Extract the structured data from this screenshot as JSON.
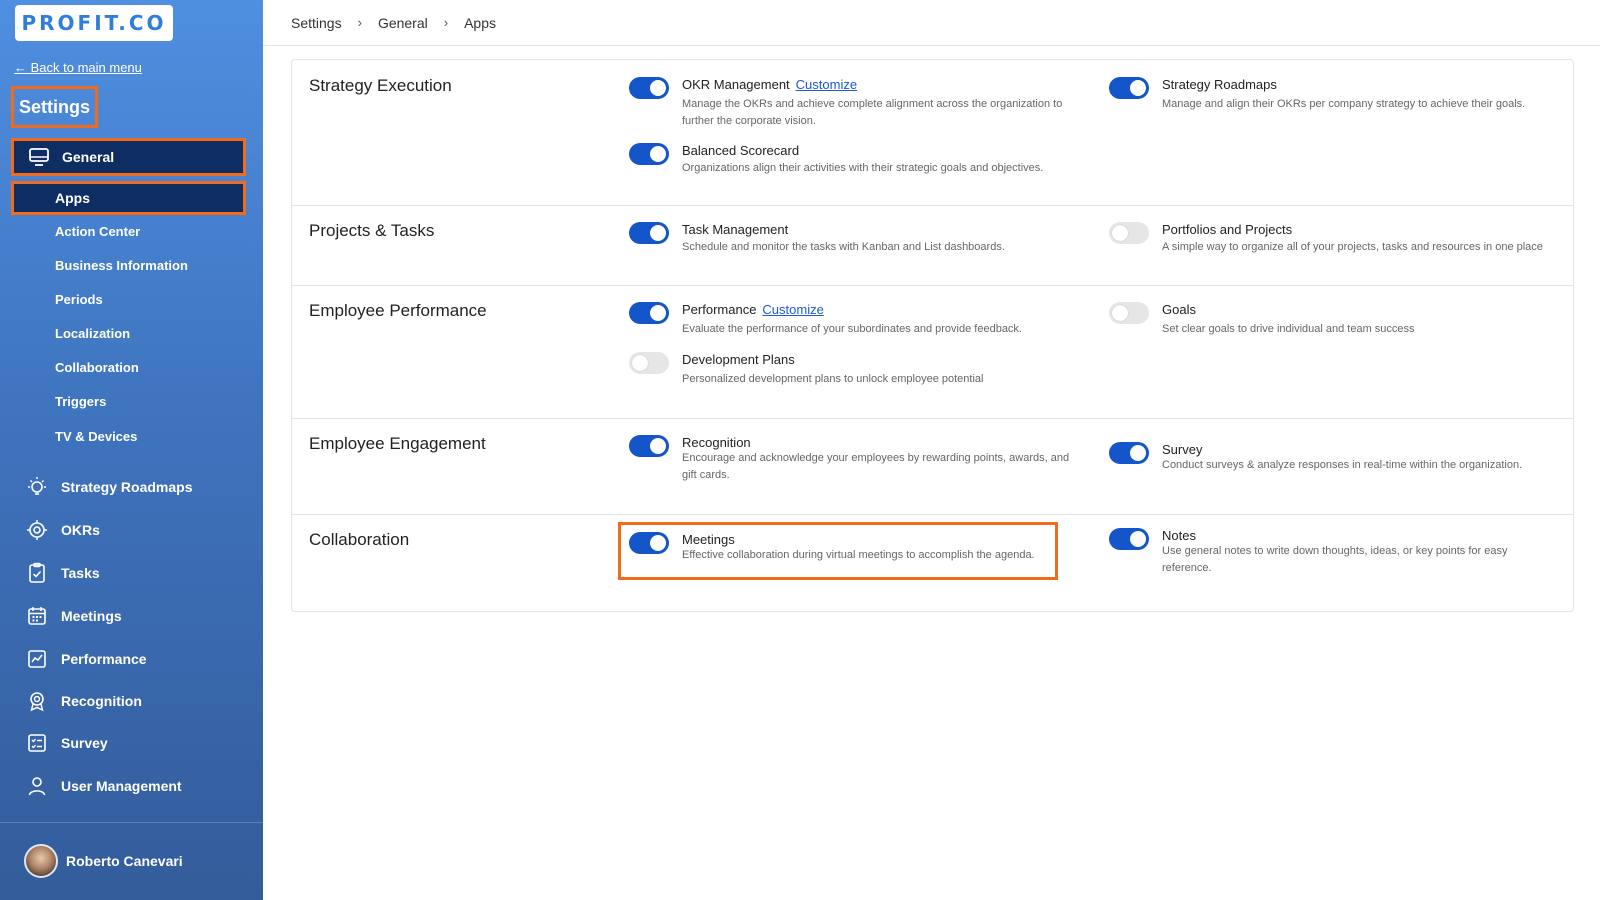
{
  "logo": {
    "text": "PROFIT.CO"
  },
  "sidebar": {
    "back_link": "← Back to main menu",
    "title": "Settings",
    "general": "General",
    "apps": "Apps",
    "subitems": [
      "Action Center",
      "Business Information",
      "Periods",
      "Localization",
      "Collaboration",
      "Triggers",
      "TV & Devices"
    ],
    "items": [
      {
        "label": "Strategy Roadmaps",
        "icon": "lightbulb-icon"
      },
      {
        "label": "OKRs",
        "icon": "target-icon"
      },
      {
        "label": "Tasks",
        "icon": "clipboard-check-icon"
      },
      {
        "label": "Meetings",
        "icon": "calendar-icon"
      },
      {
        "label": "Performance",
        "icon": "chart-line-icon"
      },
      {
        "label": "Recognition",
        "icon": "award-badge-icon"
      },
      {
        "label": "Survey",
        "icon": "survey-list-icon"
      },
      {
        "label": "User Management",
        "icon": "user-icon"
      }
    ],
    "user": {
      "name": "Roberto Canevari"
    }
  },
  "breadcrumb": [
    "Settings",
    "General",
    "Apps"
  ],
  "sections": [
    {
      "title": "Strategy Execution",
      "apps": [
        {
          "name": "OKR Management",
          "customize": "Customize",
          "enabled": true,
          "desc": "Manage the OKRs and achieve complete alignment across the organization to further the corporate vision."
        },
        {
          "name": "Strategy Roadmaps",
          "enabled": true,
          "desc": "Manage and align their OKRs per company strategy to achieve their goals."
        },
        {
          "name": "Balanced Scorecard",
          "enabled": true,
          "desc": "Organizations align their activities with their strategic goals and objectives."
        }
      ]
    },
    {
      "title": "Projects & Tasks",
      "apps": [
        {
          "name": "Task Management",
          "enabled": true,
          "desc": "Schedule and monitor the tasks with Kanban and List dashboards."
        },
        {
          "name": "Portfolios and Projects",
          "enabled": false,
          "desc": "A simple way to organize all of your projects, tasks and resources in one place"
        }
      ]
    },
    {
      "title": "Employee Performance",
      "apps": [
        {
          "name": "Performance",
          "customize": "Customize",
          "enabled": true,
          "desc": "Evaluate the performance of your subordinates and provide feedback."
        },
        {
          "name": "Goals",
          "enabled": false,
          "desc": "Set clear goals to drive individual and team success"
        },
        {
          "name": "Development Plans",
          "enabled": false,
          "desc": "Personalized development plans to unlock employee potential"
        }
      ]
    },
    {
      "title": "Employee Engagement",
      "apps": [
        {
          "name": "Recognition",
          "enabled": true,
          "desc": "Encourage and acknowledge your employees by rewarding points, awards, and gift cards."
        },
        {
          "name": "Survey",
          "enabled": true,
          "desc": "Conduct surveys & analyze responses in real-time within the organization."
        }
      ]
    },
    {
      "title": "Collaboration",
      "apps": [
        {
          "name": "Meetings",
          "enabled": true,
          "desc": "Effective collaboration during virtual meetings to accomplish the agenda."
        },
        {
          "name": "Notes",
          "enabled": true,
          "desc": "Use general notes to write down thoughts, ideas, or key points for easy reference."
        }
      ]
    }
  ],
  "colors": {
    "accent": "#1456c9",
    "highlight": "#f26a1b",
    "active_nav": "#0e2d63"
  }
}
